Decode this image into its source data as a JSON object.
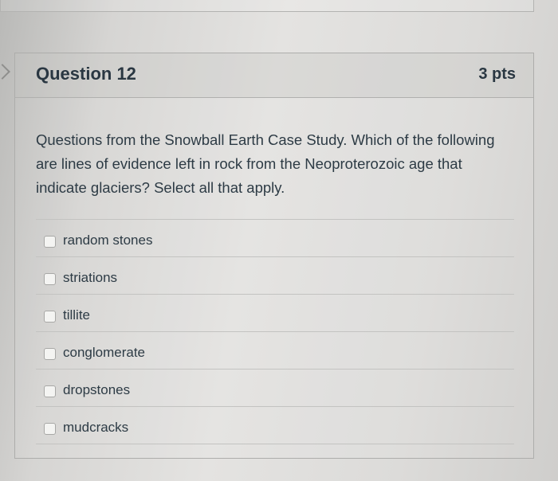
{
  "question": {
    "title": "Question 12",
    "points": "3 pts",
    "text": "Questions from the Snowball Earth Case Study. Which of the following are lines of evidence left in rock from the Neoproterozoic age that indicate glaciers? Select all that apply."
  },
  "answers": [
    {
      "label": "random stones",
      "checked": false
    },
    {
      "label": "striations",
      "checked": false
    },
    {
      "label": "tillite",
      "checked": false
    },
    {
      "label": "conglomerate",
      "checked": false
    },
    {
      "label": "dropstones",
      "checked": false
    },
    {
      "label": "mudcracks",
      "checked": false
    }
  ],
  "icons": {
    "side_nav": "chevron-right-icon"
  }
}
